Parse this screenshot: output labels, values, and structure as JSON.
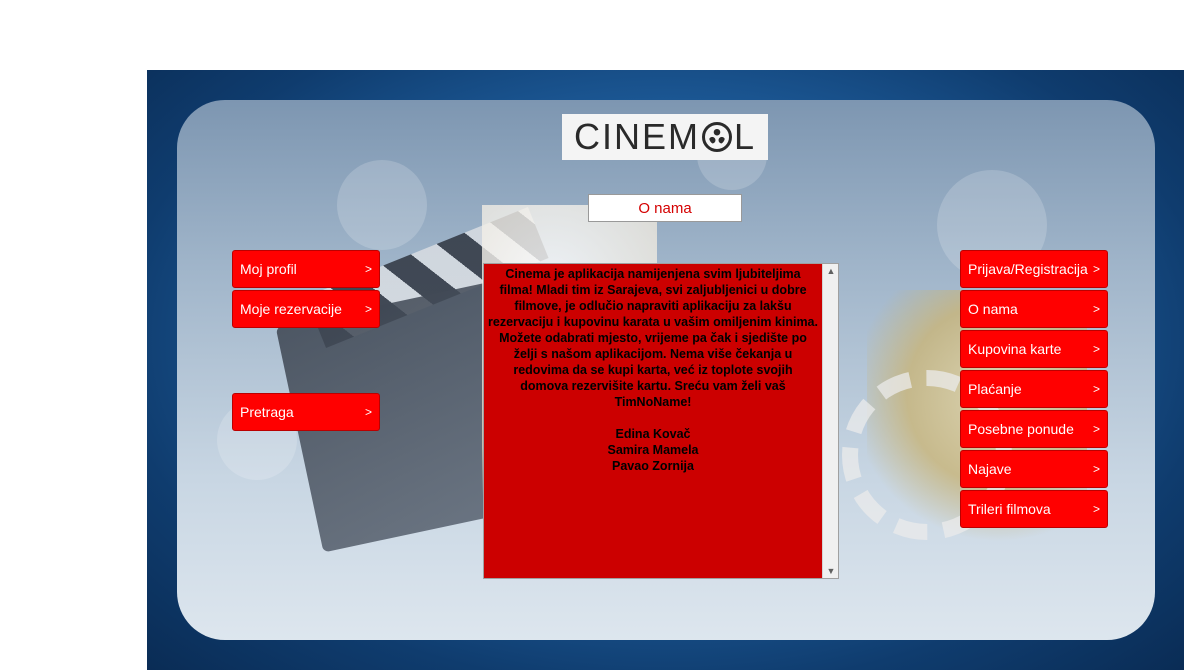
{
  "logo": {
    "text_left": "CINEM",
    "text_right": "L",
    "alt": "Cinema"
  },
  "page_heading": "O nama",
  "left_nav": [
    {
      "label": "Moj profil",
      "arrow": ">"
    },
    {
      "label": "Moje rezervacije",
      "arrow": ">"
    },
    {
      "label": "Pretraga",
      "arrow": ">"
    }
  ],
  "right_nav": [
    {
      "label": "Prijava/Registracija",
      "arrow": ">"
    },
    {
      "label": "O nama",
      "arrow": ">"
    },
    {
      "label": "Kupovina karte",
      "arrow": ">"
    },
    {
      "label": "Plaćanje",
      "arrow": ">"
    },
    {
      "label": "Posebne ponude",
      "arrow": ">"
    },
    {
      "label": "Najave",
      "arrow": ">"
    },
    {
      "label": "Trileri filmova",
      "arrow": ">"
    }
  ],
  "about": {
    "paragraph": "Cinema je aplikacija namijenjena svim ljubiteljima filma! Mladi tim iz Sarajeva, svi zaljubljenici u dobre filmove, je odlučio napraviti aplikaciju za lakšu rezervaciju i kupovinu karata u vašim omiljenim kinima. Možete odabrati mjesto, vrijeme pa čak i sjedište po želji s našom aplikacijom. Nema više čekanja u redovima da se kupi karta, već iz toplote svojih domova rezervišite kartu. Sreću vam želi vaš TimNoName!",
    "authors": [
      "Edina Kovač",
      "Samira Mamela",
      "Pavao Zornija"
    ]
  },
  "scrollbar": {
    "up_icon": "▲",
    "down_icon": "▼"
  },
  "colors": {
    "button_red": "#ff0000",
    "textbox_red": "#cc0000",
    "heading_text": "#d40000"
  }
}
